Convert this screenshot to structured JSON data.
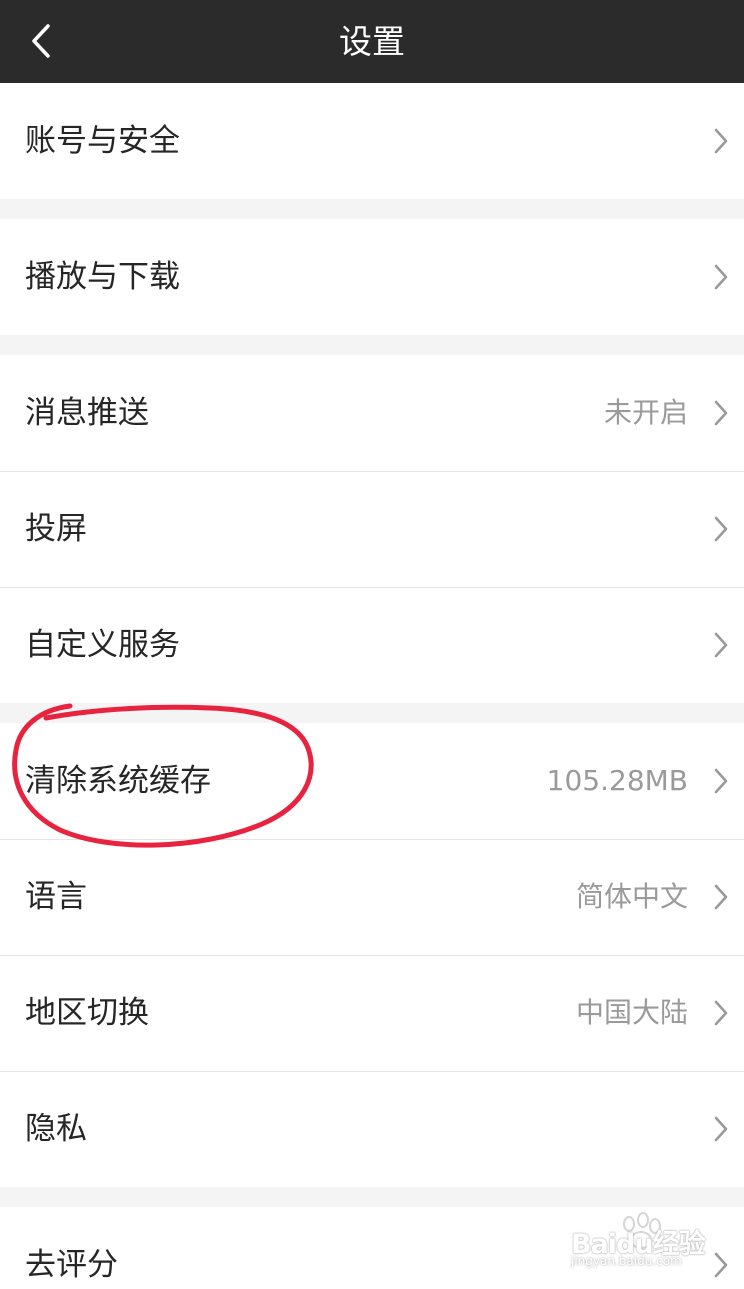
{
  "header": {
    "title": "设置",
    "back_icon": "chevron-left-icon"
  },
  "groups": [
    {
      "rows": [
        {
          "label": "账号与安全",
          "value": ""
        }
      ]
    },
    {
      "rows": [
        {
          "label": "播放与下载",
          "value": ""
        }
      ]
    },
    {
      "rows": [
        {
          "label": "消息推送",
          "value": "未开启"
        },
        {
          "label": "投屏",
          "value": ""
        },
        {
          "label": "自定义服务",
          "value": ""
        }
      ]
    },
    {
      "rows": [
        {
          "label": "清除系统缓存",
          "value": "105.28MB"
        },
        {
          "label": "语言",
          "value": "简体中文"
        },
        {
          "label": "地区切换",
          "value": "中国大陆"
        },
        {
          "label": "隐私",
          "value": ""
        }
      ]
    },
    {
      "rows": [
        {
          "label": "去评分",
          "value": ""
        }
      ]
    }
  ],
  "annotation": {
    "type": "red hand-drawn circle",
    "target": "清除系统缓存",
    "color": "#e8233f"
  },
  "watermark": {
    "brand": "Baidu经验",
    "url": "jingyan.baidu.com"
  },
  "colors": {
    "header_bg": "#2b2b2b",
    "page_bg": "#f4f4f4",
    "row_bg": "#ffffff",
    "text": "#262626",
    "secondary_text": "#9a9a9a"
  }
}
